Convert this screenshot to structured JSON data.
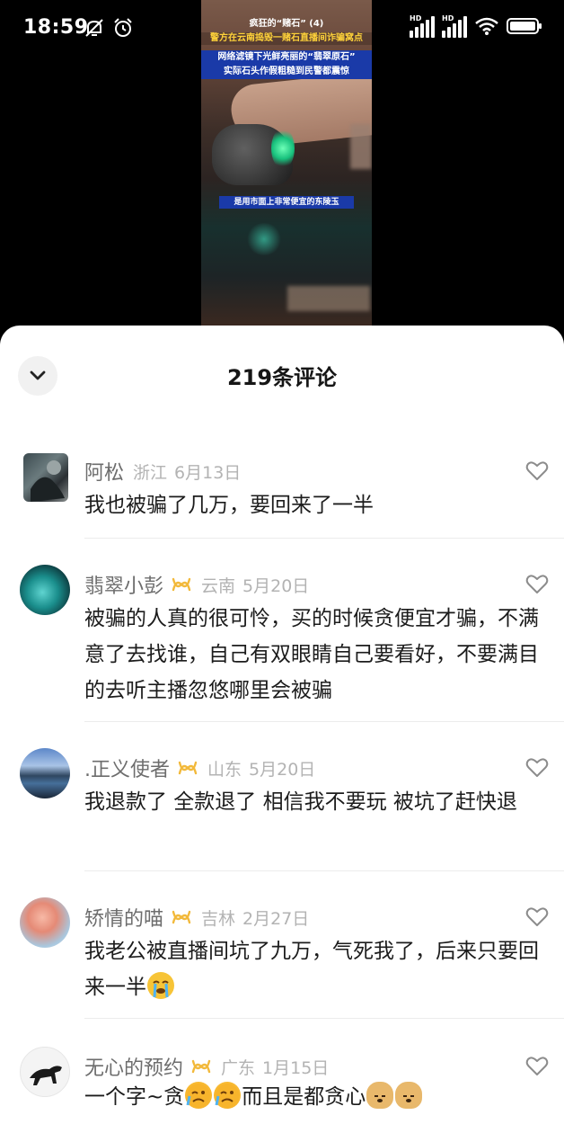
{
  "status_bar": {
    "time": "18:59",
    "hd1": "HD",
    "hd2": "HD"
  },
  "video": {
    "title_line1": "疯狂的“赌石” (4)",
    "title_line2": "警方在云南捣毁一赌石直播间诈骗窝点",
    "title_line3": "网络滤镜下光鲜亮丽的“翡翠原石”",
    "title_line4": "实际石头作假粗糙到民警都震惊",
    "caption": "是用市面上非常便宜的东陵玉"
  },
  "sheet": {
    "title": "219条评论"
  },
  "comments": [
    {
      "name": "阿松",
      "location": "浙江",
      "date": "6月13日",
      "text": "我也被骗了几万，要回来了一半",
      "badge": false
    },
    {
      "name": "翡翠小彭",
      "location": "云南",
      "date": "5月20日",
      "text": "被骗的人真的很可怜，买的时候贪便宜才骗，不满意了去找谁，自己有双眼睛自己要看好，不要满目的去听主播忽悠哪里会被骗",
      "badge": true
    },
    {
      "name": ".正义使者",
      "location": "山东",
      "date": "5月20日",
      "text": "我退款了 全款退了  相信我不要玩 被坑了赶快退",
      "badge": true
    },
    {
      "name": "矫情的喵",
      "location": "吉林",
      "date": "2月27日",
      "text": "我老公被直播间坑了九万，气死我了，后来只要回来一半",
      "badge": true
    },
    {
      "name": "无心的预约",
      "location": "广东",
      "date": "1月15日",
      "text_a": "一个字~贪",
      "text_b": "而且是都贪心",
      "badge": true
    }
  ],
  "icons": {
    "collapse": "chevron-down-icon",
    "like": "heart-outline-icon",
    "badge": "infinity-badge-icon"
  },
  "colors": {
    "badge": "#f2b93b",
    "accent_text": "#1c1c1c",
    "meta": "#b3b3b3"
  }
}
